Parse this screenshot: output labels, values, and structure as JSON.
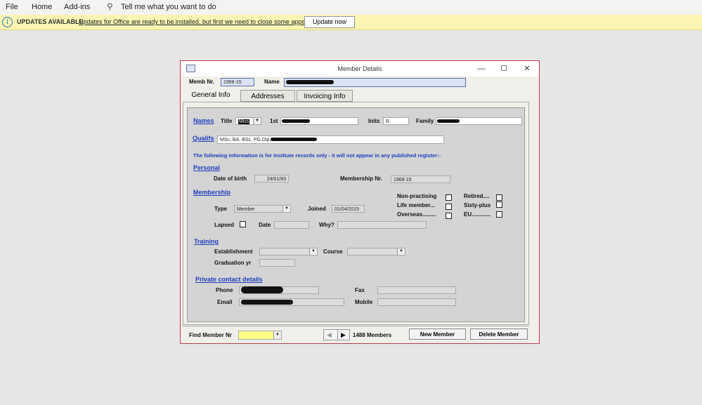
{
  "ribbon": {
    "file": "File",
    "home": "Home",
    "addins": "Add-ins",
    "search_placeholder": "Tell me what you want to do"
  },
  "updates": {
    "title": "UPDATES AVAILABLE",
    "message": "Updates for Office are ready to be installed, but first we need to close some apps.",
    "button": "Update now"
  },
  "window": {
    "title": "Member Details",
    "minimize": "—",
    "maximize": "☐",
    "close": "✕"
  },
  "header": {
    "memb_nr_label": "Memb Nr.",
    "memb_nr": "1968-15",
    "name_label": "Name"
  },
  "tabs": [
    {
      "label": "General Info"
    },
    {
      "label": "Addresses"
    },
    {
      "label": "Invoicing Info"
    }
  ],
  "names": {
    "section": "Names",
    "title_label": "Title",
    "title_value": "Miss",
    "first_label": "1st",
    "inits_label": "Inits",
    "inits_value": "R.",
    "family_label": "Family"
  },
  "qualifs": {
    "section": "Qualifs",
    "value": "MSc, BA, BSc, PG.Dip,"
  },
  "note": "The following information is for Institute records only - it will not appear in any published register:-",
  "personal": {
    "section": "Personal",
    "dob_label": "Date of birth",
    "dob": "24/01/83",
    "membership_nr_label": "Membership Nr.",
    "membership_nr": "1968-15"
  },
  "membership": {
    "section": "Membership",
    "type_label": "Type",
    "type_value": "Member",
    "joined_label": "Joined",
    "joined": "01/04/2015",
    "lapsed_label": "Lapsed",
    "date_label": "Date",
    "why_label": "Why?",
    "checks": {
      "non_practising": "Non-practising",
      "life_member": "Life member...",
      "overseas": "Overseas.........",
      "retired": "Retired....",
      "sixty_plus": "Sixty-plus",
      "eu": "EU............"
    }
  },
  "training": {
    "section": "Training",
    "establishment_label": "Establishment",
    "course_label": "Course",
    "graduation_label": "Graduation yr"
  },
  "contact": {
    "section": "Private contact details",
    "phone_label": "Phone",
    "fax_label": "Fax",
    "email_label": "Email",
    "mobile_label": "Mobile"
  },
  "footer": {
    "find_label": "Find Member Nr",
    "count": "1488 Members",
    "new_member": "New Member",
    "delete_member": "Delete Member"
  }
}
